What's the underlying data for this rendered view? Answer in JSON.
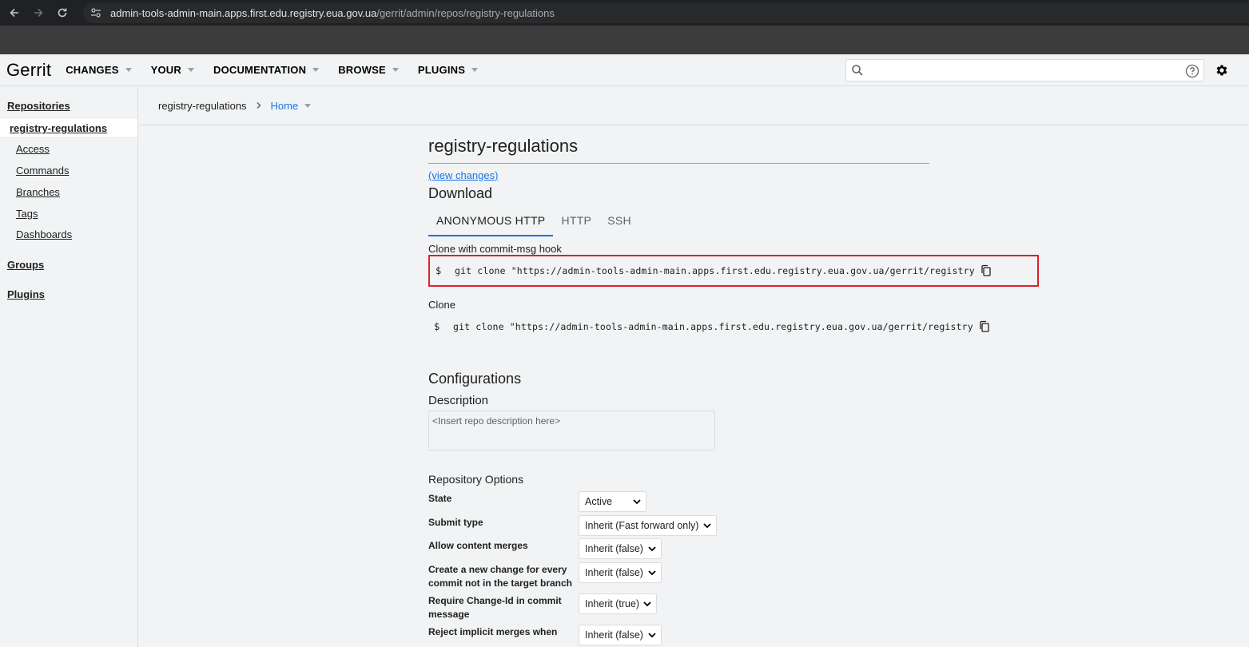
{
  "browser": {
    "url_host": "admin-tools-admin-main.apps.first.edu.registry.eua.gov.ua",
    "url_path": "/gerrit/admin/repos/registry-regulations"
  },
  "header": {
    "logo": "Gerrit",
    "menus": [
      "CHANGES",
      "YOUR",
      "DOCUMENTATION",
      "BROWSE",
      "PLUGINS"
    ],
    "search_value": ""
  },
  "sidebar": {
    "repositories": "Repositories",
    "current_repo": "registry-regulations",
    "sub_items": [
      "Access",
      "Commands",
      "Branches",
      "Tags",
      "Dashboards"
    ],
    "groups": "Groups",
    "plugins": "Plugins"
  },
  "breadcrumb": {
    "repo": "registry-regulations",
    "page": "Home"
  },
  "main": {
    "title": "registry-regulations",
    "view_changes": "(view changes)",
    "download_heading": "Download",
    "tabs": [
      "ANONYMOUS HTTP",
      "HTTP",
      "SSH"
    ],
    "clone_hook_label": "Clone with commit-msg hook",
    "clone_hook_cmd": "git clone \"https://admin-tools-admin-main.apps.first.edu.registry.eua.gov.ua/gerrit/registry-",
    "clone_label": "Clone",
    "clone_cmd": "git clone \"https://admin-tools-admin-main.apps.first.edu.registry.eua.gov.ua/gerrit/registry-",
    "dollar": "$",
    "config_heading": "Configurations",
    "description_heading": "Description",
    "description_placeholder": "<Insert repo description here>",
    "repo_options_heading": "Repository Options",
    "options": [
      {
        "label": "State",
        "value": "Active"
      },
      {
        "label": "Submit type",
        "value": "Inherit (Fast forward only)"
      },
      {
        "label": "Allow content merges",
        "value": "Inherit (false)"
      },
      {
        "label": "Create a new change for every commit not in the target branch",
        "value": "Inherit (false)"
      },
      {
        "label": "Require Change-Id in commit message",
        "value": "Inherit (true)"
      },
      {
        "label": "Reject implicit merges when",
        "value": "Inherit (false)"
      }
    ]
  }
}
